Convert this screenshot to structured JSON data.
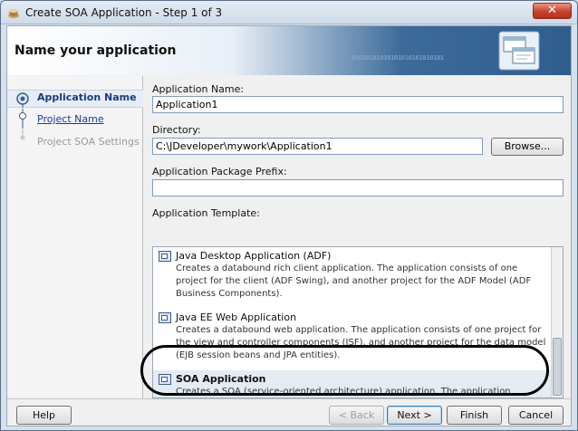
{
  "window": {
    "title": "Create SOA Application - Step 1 of 3",
    "close_glyph": "✕",
    "title_icon": "jdeveloper-cup-icon"
  },
  "header": {
    "title": "Name your application",
    "binary_text": "01010101010101010101010101",
    "art_icon": "wizard-windows-icon"
  },
  "steps": [
    {
      "label": "Application Name",
      "state": "current"
    },
    {
      "label": "Project Name",
      "state": "link"
    },
    {
      "label": "Project SOA Settings",
      "state": "disabled"
    }
  ],
  "form": {
    "app_name_label": "Application Name:",
    "app_name_value": "Application1",
    "directory_label": "Directory:",
    "directory_value": "C:\\JDeveloper\\mywork\\Application1",
    "browse_label": "Browse...",
    "package_prefix_label": "Application Package Prefix:",
    "package_prefix_value": "",
    "template_label": "Application Template:"
  },
  "templates": [
    {
      "name": "Java Desktop Application (ADF)",
      "description": "Creates a databound rich client application. The application consists of one project for the client (ADF Swing), and another project for the ADF Model (ADF Business Components).",
      "selected": false
    },
    {
      "name": "Java EE Web Application",
      "description": "Creates a databound web application. The application consists of one project for the view and controller components (JSF), and another project for the data model (EJB session beans and JPA entities).",
      "selected": false
    },
    {
      "name": "SOA Application",
      "description": "Creates a SOA (service-oriented architecture) application. The application consists of one SOA project for the SOA composite, components, and adapters.",
      "selected": true
    }
  ],
  "footer": {
    "help": "Help",
    "back": "< Back",
    "next": "Next >",
    "finish": "Finish",
    "cancel": "Cancel"
  }
}
